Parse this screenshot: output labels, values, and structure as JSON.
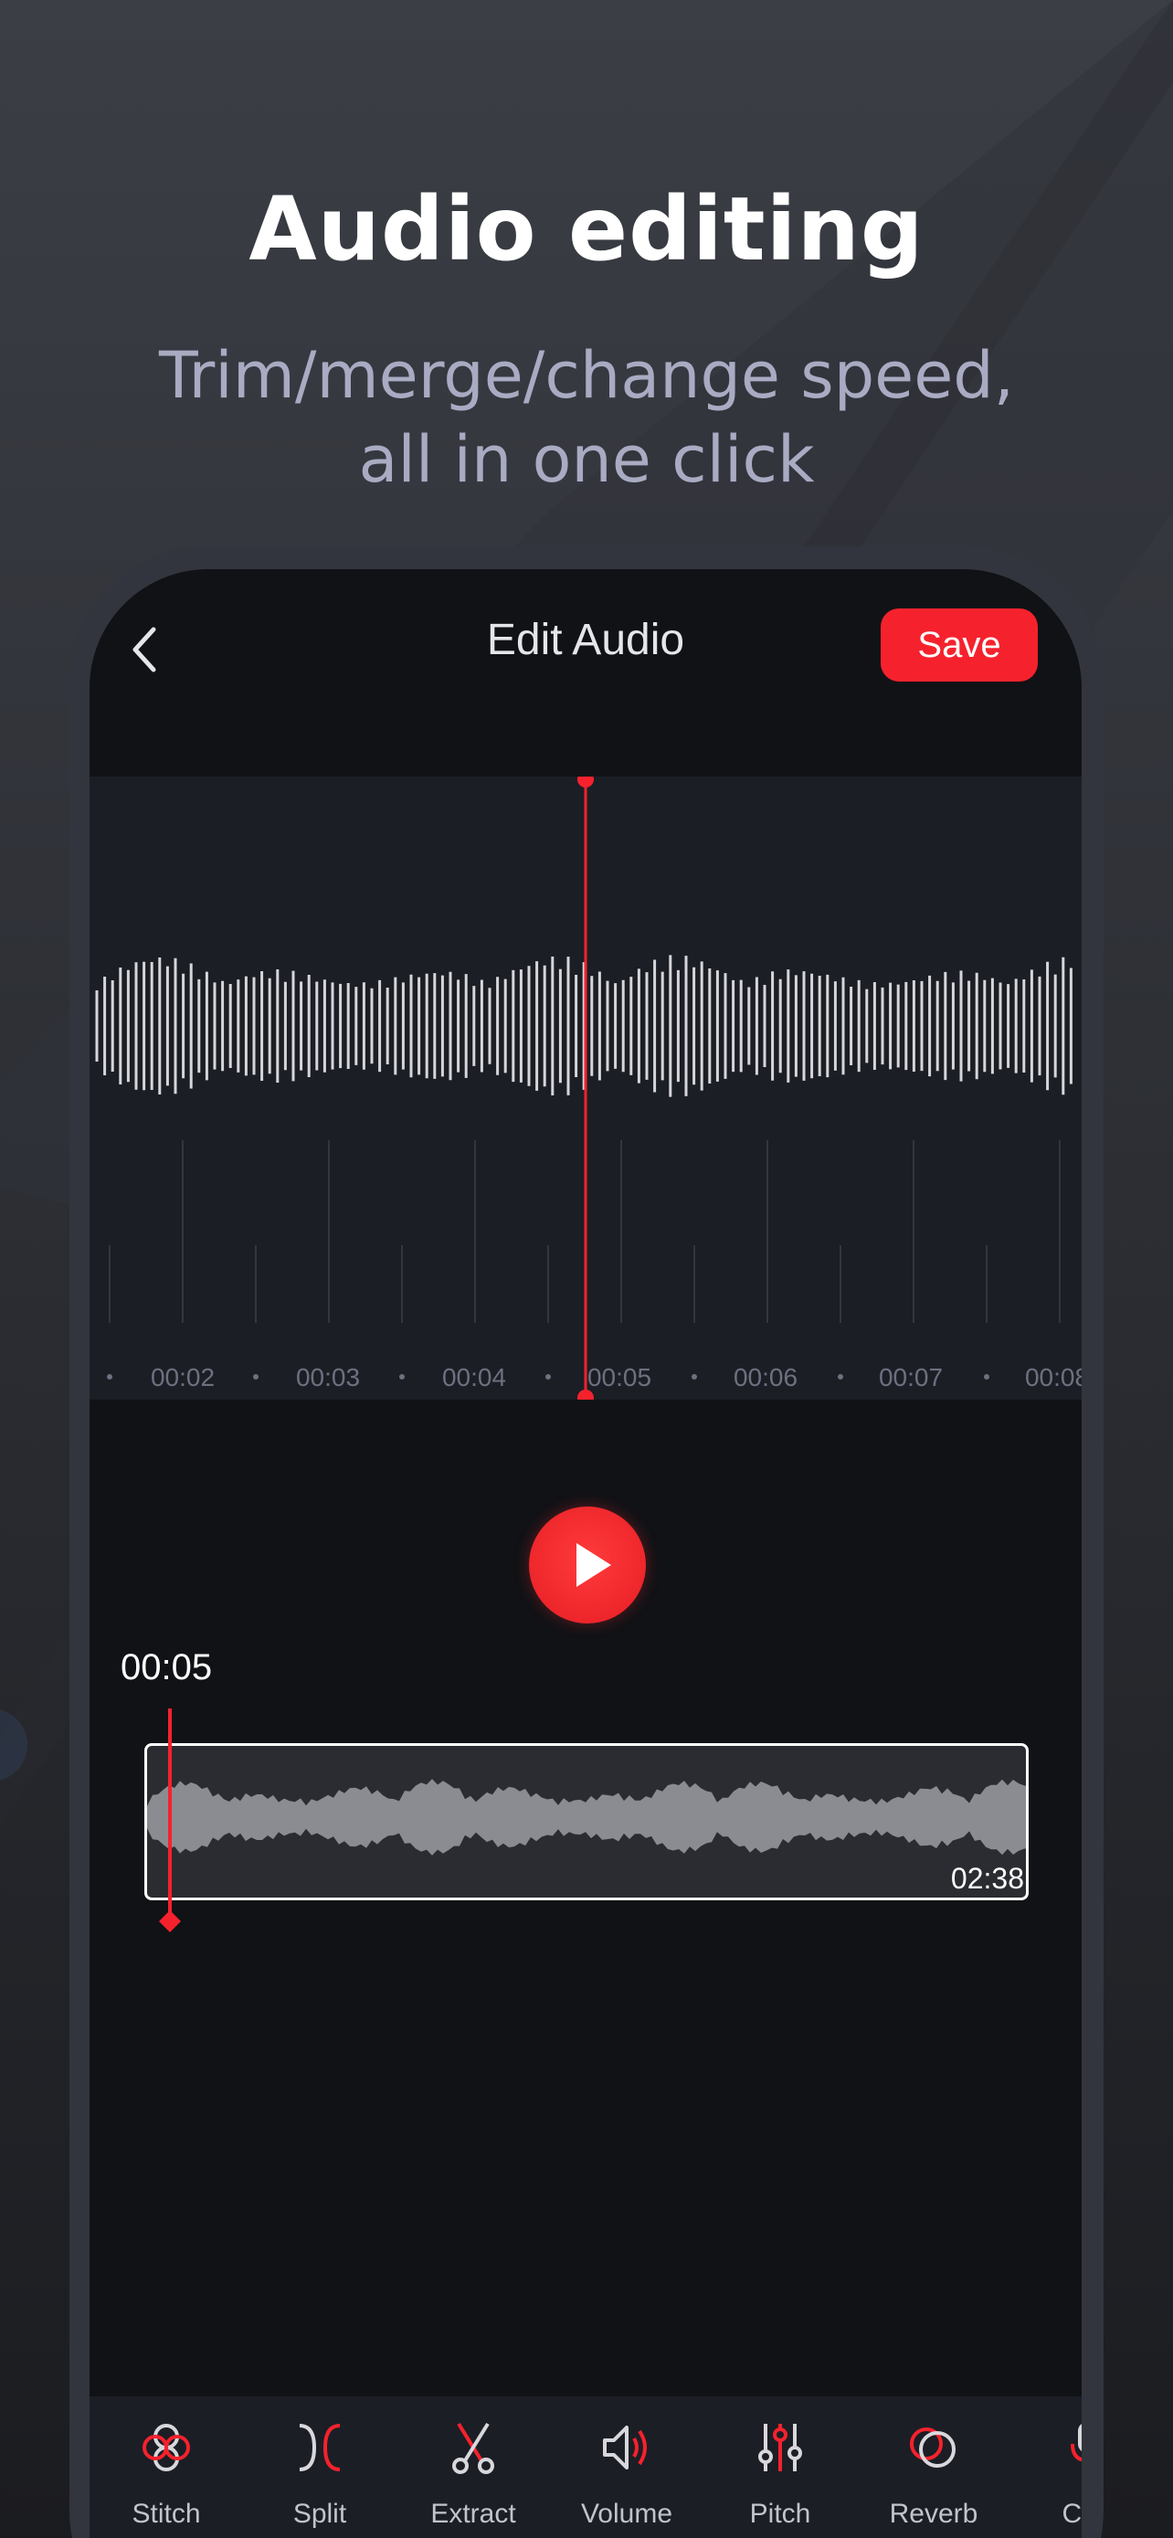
{
  "promo": {
    "title": "Audio editing",
    "subtitle_line1": "Trim/merge/change speed,",
    "subtitle_line2": "all in one click"
  },
  "header": {
    "back_icon": "chevron-left-icon",
    "title": "Edit Audio",
    "save_label": "Save"
  },
  "timeline": {
    "tick_labels": [
      "00:02",
      "00:03",
      "00:04",
      "00:05",
      "00:06",
      "00:07",
      "00:08"
    ]
  },
  "player": {
    "play_icon": "play-icon",
    "current_time": "00:05",
    "duration": "02:38"
  },
  "tools": [
    {
      "label": "Stitch",
      "icon": "stitch-icon"
    },
    {
      "label": "Split",
      "icon": "split-icon"
    },
    {
      "label": "Extract",
      "icon": "scissors-icon"
    },
    {
      "label": "Volume",
      "icon": "volume-icon"
    },
    {
      "label": "Pitch",
      "icon": "sliders-icon"
    },
    {
      "label": "Reverb",
      "icon": "reverb-icon"
    },
    {
      "label": "Cha",
      "icon": "microphone-icon"
    }
  ],
  "colors": {
    "accent": "#f5222d",
    "background": "#111216",
    "panel": "#1c1e25",
    "waveform": "#d6d6da"
  }
}
